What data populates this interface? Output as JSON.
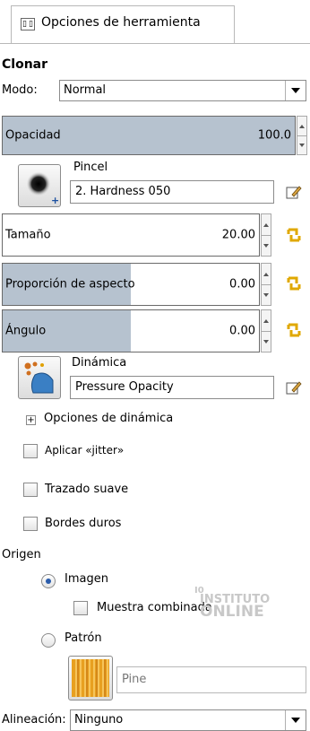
{
  "tab": {
    "icon": "tool-options-icon",
    "label": "Opciones de herramienta"
  },
  "tool": {
    "name": "Clonar"
  },
  "mode": {
    "label": "Modo:",
    "value": "Normal"
  },
  "opacity": {
    "label": "Opacidad",
    "value": "100.0",
    "fraction": 1.0
  },
  "brush": {
    "label": "Pincel",
    "value": "2. Hardness 050"
  },
  "size": {
    "label": "Tamaño",
    "value": "20.00",
    "fraction": 0.0
  },
  "aspect": {
    "label": "Proporción de aspecto",
    "value": "0.00",
    "fraction": 0.5
  },
  "angle": {
    "label": "Ángulo",
    "value": "0.00",
    "fraction": 0.5
  },
  "dynamics": {
    "label": "Dinámica",
    "value": "Pressure Opacity"
  },
  "dynamics_options": {
    "label": "Opciones de dinámica"
  },
  "jitter": {
    "label": "Aplicar «jitter»",
    "checked": false
  },
  "smooth": {
    "label": "Trazado suave",
    "checked": false
  },
  "hard_edges": {
    "label": "Bordes duros",
    "checked": false
  },
  "source": {
    "label": "Origen",
    "image": {
      "label": "Imagen",
      "selected": true
    },
    "sample_merged": {
      "label": "Muestra combinada",
      "checked": false
    },
    "pattern": {
      "label": "Patrón",
      "selected": false
    },
    "pattern_name": "Pine"
  },
  "alignment": {
    "label": "Alineación:",
    "value": "Ninguno"
  },
  "watermark": {
    "line1": "INSTITUTO",
    "line2": "ONLINE"
  },
  "colors": {
    "slider_fill": "#b6c2cf",
    "radio_dot": "#2a5cab",
    "chain": "#e0a800",
    "pattern": "#e8a020"
  }
}
